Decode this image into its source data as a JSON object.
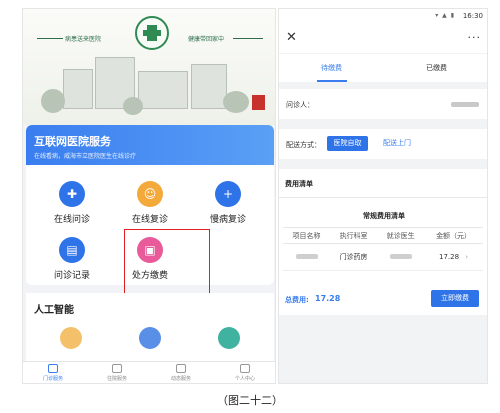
{
  "left_app": {
    "banner": {
      "slogan_left": "病患送来医院",
      "slogan_right": "健康带回家中"
    },
    "service": {
      "title": "互联网医院服务",
      "subtitle": "在线看病，威海市立医院医生在线诊疗",
      "items": [
        {
          "label": "在线问诊",
          "icon": "medical-bag-icon",
          "color": "#2f73e8"
        },
        {
          "label": "在线复诊",
          "icon": "doctor-icon",
          "color": "#f4a93b"
        },
        {
          "label": "慢病复诊",
          "icon": "plus-circle-icon",
          "color": "#2f73e8"
        },
        {
          "label": "问诊记录",
          "icon": "records-icon",
          "color": "#2f73e8"
        },
        {
          "label": "处方缴费",
          "icon": "wallet-icon",
          "color": "#e85a9a"
        }
      ]
    },
    "ai": {
      "title": "人工智能"
    },
    "tabbar": [
      {
        "label": "门诊服务",
        "active": true
      },
      {
        "label": "住院服务",
        "active": false
      },
      {
        "label": "动态服务",
        "active": false
      },
      {
        "label": "个人中心",
        "active": false
      }
    ]
  },
  "right_app": {
    "status_time": "16:30",
    "tabs": {
      "unpaid": "待缴费",
      "paid": "已缴费"
    },
    "patient_label": "问诊人：",
    "delivery": {
      "label": "配送方式：",
      "selected": "医院自取",
      "other": "配送上门"
    },
    "bill": {
      "title": "费用清单",
      "subtitle": "常规费用清单",
      "columns": [
        "项目名称",
        "执行科室",
        "就诊医生",
        "金额（元）"
      ],
      "rows": [
        {
          "department": "门诊药房",
          "amount": "17.28"
        }
      ],
      "total_label": "总费用:",
      "total_value": "17.28",
      "pay_button": "立即缴费"
    }
  },
  "caption": "（图二十二）"
}
